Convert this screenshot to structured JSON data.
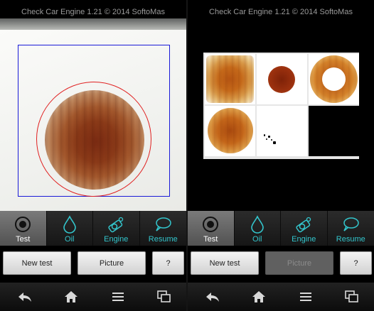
{
  "app": {
    "title": "Check Car Engine 1.21 © 2014 SoftoMas"
  },
  "tabs": [
    {
      "label": "Test",
      "icon": "target-icon"
    },
    {
      "label": "Oil",
      "icon": "drop-icon"
    },
    {
      "label": "Engine",
      "icon": "engine-icon"
    },
    {
      "label": "Resume",
      "icon": "speech-bubble-icon"
    }
  ],
  "buttons": {
    "new_test": "New test",
    "picture": "Picture",
    "help": "?"
  },
  "navigation": [
    "back-icon",
    "home-icon",
    "menu-icon",
    "recent-apps-icon"
  ],
  "left_screen": {
    "selected_tab": "Test",
    "picture_enabled": true
  },
  "right_screen": {
    "selected_tab": "Test",
    "picture_enabled": false
  },
  "colors": {
    "accent": "#33c5cc",
    "guide_box": "#1a1ad8",
    "detection_circle": "#e02020"
  }
}
